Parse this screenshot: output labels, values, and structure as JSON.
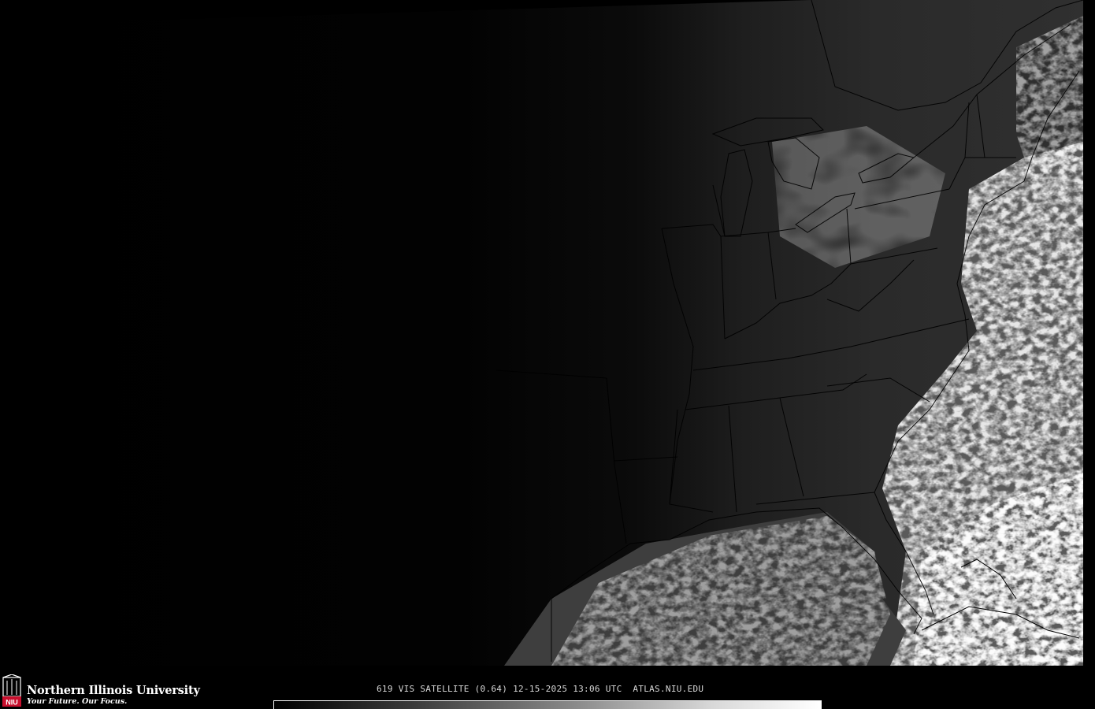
{
  "footer": {
    "org_name": "Northern Illinois University",
    "tagline": "Your Future. Our Focus.",
    "seal_text": "NIU",
    "caption": "619 VIS SATELLITE (0.64) 12-15-2025 13:06 UTC  ATLAS.NIU.EDU"
  },
  "colors": {
    "background": "#000000",
    "land_night": "#0c0c0c",
    "land_day": "#2a2a2a",
    "cloud": "#e8e8e8",
    "border_lines": "#000000",
    "niu_red": "#c8102e"
  },
  "map": {
    "projection_area": "Eastern United States",
    "day_night_terminator": "left portion in night darkness"
  }
}
